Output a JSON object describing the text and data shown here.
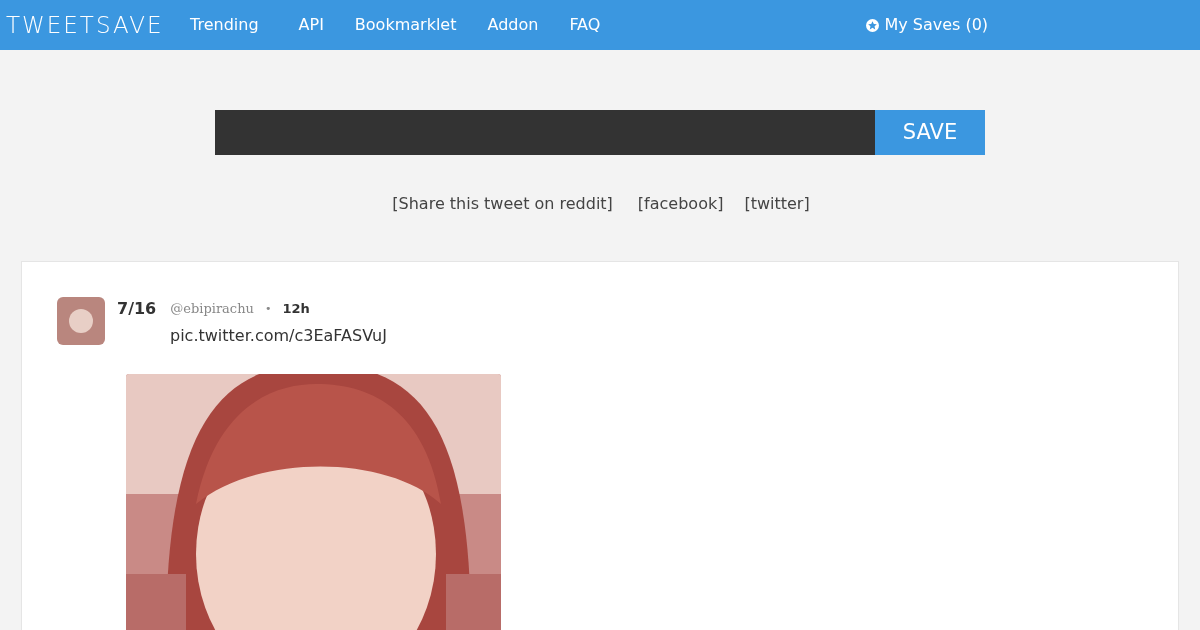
{
  "header": {
    "logo": "TWEETSAVE",
    "nav": [
      "Trending",
      "API",
      "Bookmarklet",
      "Addon",
      "FAQ"
    ],
    "saves": "My Saves (0)"
  },
  "save_form": {
    "button": "SAVE"
  },
  "share_links": [
    "[Share this tweet on reddit]",
    "[facebook]",
    "[twitter]"
  ],
  "tweet": {
    "name": "7/16",
    "handle": "@ebipirachu",
    "separator": "•",
    "time": "12h",
    "text": "pic.twitter.com/c3EaFASVuJ"
  }
}
